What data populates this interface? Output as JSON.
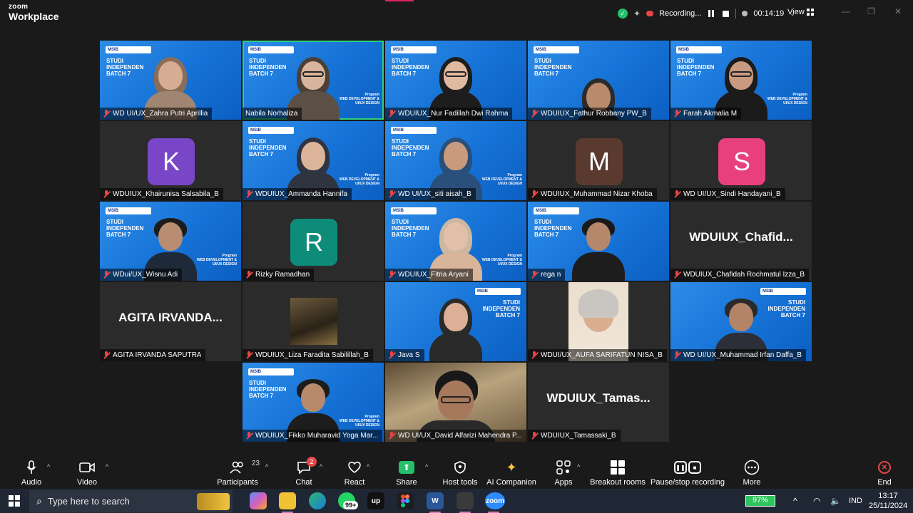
{
  "app": {
    "logo_line1": "zoom",
    "logo_line2": "Workplace"
  },
  "topbar": {
    "recording_label": "Recording...",
    "timer": "00:14:19",
    "view_label": "View"
  },
  "slide": {
    "title": "STUDI\nINDEPENDEN\nBATCH 7",
    "brand": "MSIB",
    "program": "Program\nWEB DEVELOPMENT &\nUI/UX DESIGN"
  },
  "participants": [
    {
      "name": "WD UI/UX_Zahra Putri Aprillia",
      "type": "video",
      "muted": true
    },
    {
      "name": "Nabila Norhaliza",
      "type": "video",
      "muted": false,
      "active": true
    },
    {
      "name": "WDUIUX_Nur Fadillah Dwi Rahma",
      "type": "video",
      "muted": true
    },
    {
      "name": "WDUIUX_Fathur Robbany PW_B",
      "type": "video",
      "muted": true
    },
    {
      "name": "Farah Akmalia M",
      "type": "video",
      "muted": true
    },
    {
      "name": "WDUIUX_Khairunisa Salsabila_B",
      "type": "avatar",
      "initial": "K",
      "color": "#7a46c8",
      "muted": true
    },
    {
      "name": "WDUIUX_Ammanda Hannifa",
      "type": "video",
      "muted": true
    },
    {
      "name": "WD UI/UX_siti aisah_B",
      "type": "video",
      "muted": true
    },
    {
      "name": "WDUIUX_Muhammad Nizar Khoba",
      "type": "avatar",
      "initial": "M",
      "color": "#5a3a2e",
      "muted": true
    },
    {
      "name": "WD UI/UX_Sindi Handayani_B",
      "type": "avatar",
      "initial": "S",
      "color": "#e8407c",
      "muted": true
    },
    {
      "name": "WDui/UX_Wisnu Adi",
      "type": "video",
      "muted": true
    },
    {
      "name": "Rizky Ramadhan",
      "type": "avatar",
      "initial": "R",
      "color": "#0e8c7a",
      "muted": true
    },
    {
      "name": "WDUIUX_Fitria Aryani",
      "type": "video",
      "muted": true
    },
    {
      "name": "rega n",
      "type": "video",
      "muted": true
    },
    {
      "name": "WDUIUX_Chafidah Rochmatul Izza_B",
      "type": "text",
      "display": "WDUIUX_Chafid...",
      "muted": true
    },
    {
      "name": "AGITA IRVANDA SAPUTRA",
      "type": "text",
      "display": "AGITA IRVANDA...",
      "muted": true
    },
    {
      "name": "WDUIUX_Liza Faradita Sabilillah_B",
      "type": "photo",
      "muted": true
    },
    {
      "name": "Java S",
      "type": "video",
      "muted": true
    },
    {
      "name": "WDUI/UX_AUFA SARIFATUN NISA_B",
      "type": "photo",
      "muted": true
    },
    {
      "name": "WD UI/UX_Muhammad Irfan Daffa_B",
      "type": "video",
      "muted": true
    },
    {
      "name": "WDUIUX_Fikko Muharavid Yoga Mar...",
      "type": "video",
      "muted": true
    },
    {
      "name": "WD UI/UX_David Alfarizi Mahendra P...",
      "type": "video",
      "muted": true
    },
    {
      "name": "WDUIUX_Tamassaki_B",
      "type": "text",
      "display": "WDUIUX_Tamas...",
      "muted": true
    }
  ],
  "toolbar": {
    "audio": "Audio",
    "video": "Video",
    "participants": "Participants",
    "participants_count": "23",
    "chat": "Chat",
    "chat_badge": "2",
    "react": "React",
    "share": "Share",
    "host_tools": "Host tools",
    "ai_companion": "AI Companion",
    "apps": "Apps",
    "breakout_rooms": "Breakout rooms",
    "pause_stop": "Pause/stop recording",
    "more": "More",
    "end": "End"
  },
  "taskbar": {
    "search_placeholder": "Type here to search",
    "whatsapp_badge": "99+",
    "battery": "97%",
    "language": "IND",
    "time": "13:17",
    "date": "25/11/2024"
  },
  "colors": {
    "active_speaker": "#2fd07a",
    "muted_red": "#e84646",
    "share_green": "#26c06a"
  }
}
